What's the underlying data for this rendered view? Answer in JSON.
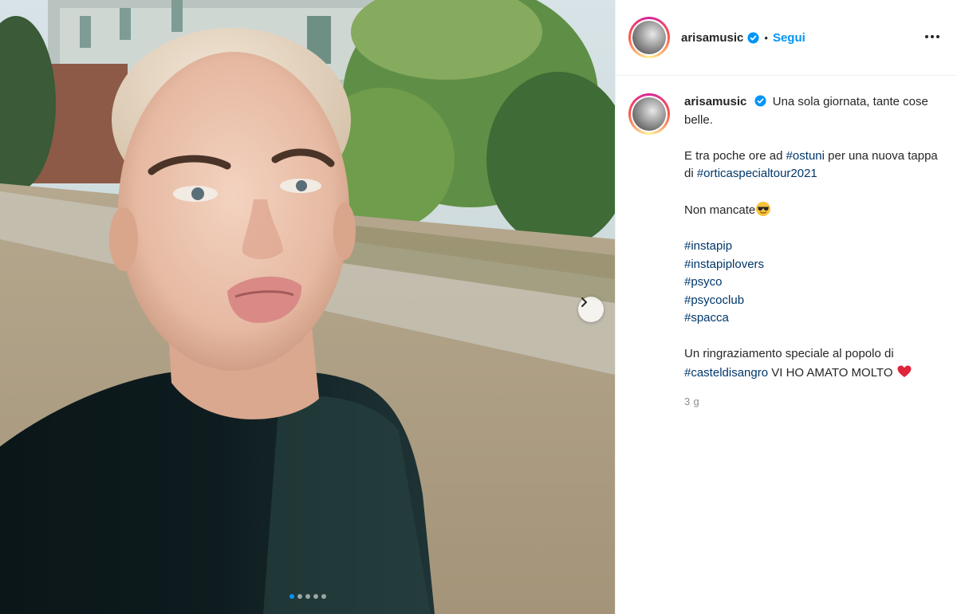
{
  "post": {
    "username": "arisamusic",
    "separator": "•",
    "follow_label": "Segui",
    "more_icon": "more-horizontal-icon",
    "carousel": {
      "total_slides": 5,
      "active_index": 0
    }
  },
  "caption": {
    "username": "arisamusic",
    "line1_text": "Una sola giornata, tante cose belle.",
    "line2_prefix": "E tra poche ore ad ",
    "tag_ostuni": "#ostuni",
    "line2_middle": " per una nuova tappa di ",
    "tag_tour": "#orticaspecialtour2021",
    "line3_text": "Non mancate",
    "emoji_sunglasses": "sunglasses-emoji",
    "hashtags": [
      "#instapip",
      "#instapiplovers",
      "#psyco",
      "#psycoclub",
      "#spacca"
    ],
    "thanks_prefix": "Un ringraziamento speciale al popolo di ",
    "tag_castel": "#casteldisangro",
    "thanks_suffix": " VI HO AMATO MOLTO ",
    "emoji_heart": "red-heart-emoji"
  },
  "timestamp": "3 g",
  "colors": {
    "accent": "#0095f6",
    "hashtag": "#00376b",
    "muted": "#8e8e8e",
    "text": "#262626"
  }
}
